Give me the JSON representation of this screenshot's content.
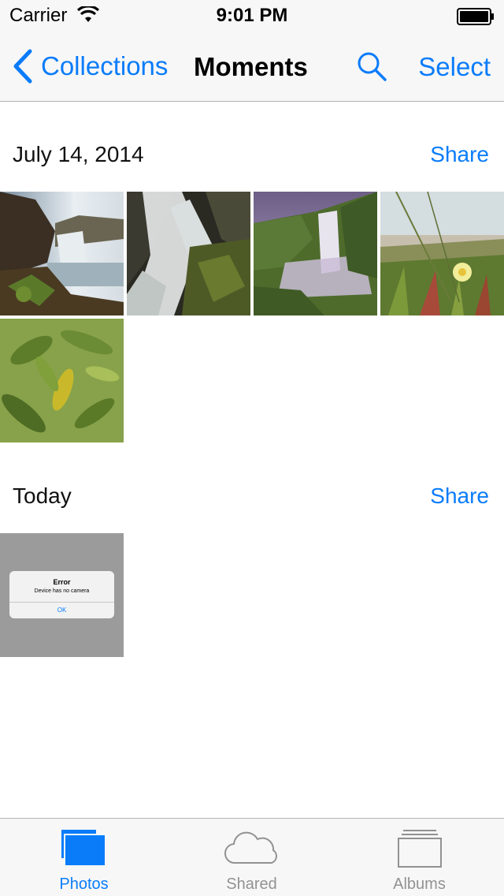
{
  "status_bar": {
    "carrier": "Carrier",
    "time": "9:01 PM"
  },
  "nav": {
    "back_label": "Collections",
    "title": "Moments",
    "select_label": "Select"
  },
  "sections": [
    {
      "date": "July 14, 2014",
      "share_label": "Share",
      "photos": [
        "waterfall-sunlit",
        "waterfall-closeup",
        "waterfall-misty",
        "beach-flower",
        "green-leaves"
      ]
    },
    {
      "date": "Today",
      "share_label": "Share",
      "photos": [
        "error-screenshot"
      ]
    }
  ],
  "error_screenshot": {
    "title": "Error",
    "message": "Device has no camera",
    "button": "OK"
  },
  "tabs": [
    {
      "label": "Photos",
      "icon": "photos-icon",
      "active": true
    },
    {
      "label": "Shared",
      "icon": "cloud-icon",
      "active": false
    },
    {
      "label": "Albums",
      "icon": "albums-icon",
      "active": false
    }
  ],
  "colors": {
    "accent": "#0a7cfa",
    "inactive": "#929292"
  }
}
